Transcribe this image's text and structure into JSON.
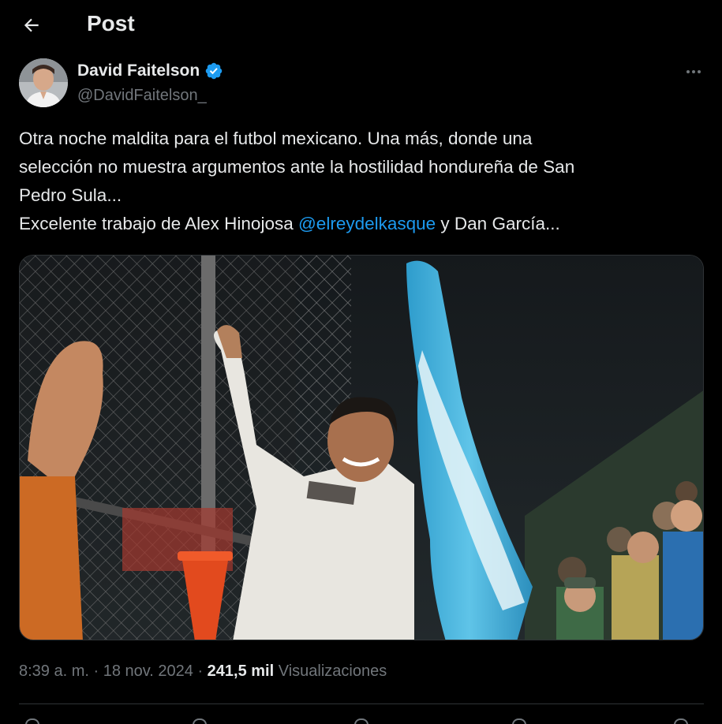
{
  "header": {
    "back_icon": "arrow-left-icon",
    "title": "Post"
  },
  "author": {
    "name": "David Faitelson",
    "handle": "@DavidFaitelson_",
    "verified_icon": "verified-badge-icon",
    "verified_color": "#1d9bf0",
    "more_icon": "more-horizontal-icon"
  },
  "post": {
    "line1": "Otra noche maldita para el futbol mexicano. Una más, donde una",
    "line2": "selección no muestra argumentos ante la hostilidad hondureña de San",
    "line3": "Pedro Sula...",
    "line4_before": "Excelente trabajo de Alex Hinojosa ",
    "line4_mention": "@elreydelkasque",
    "line4_after": " y Dan García...",
    "mention_color": "#1d9bf0"
  },
  "meta": {
    "time": "8:39 a. m.",
    "separator": " · ",
    "date": "18 nov. 2024",
    "views_count": "241,5 mil",
    "views_label": "Visualizaciones"
  },
  "actions": {
    "icons": [
      "reply-icon",
      "repost-icon",
      "like-icon",
      "bookmark-icon",
      "share-icon"
    ]
  },
  "colors": {
    "background": "#000000",
    "text": "#e7e9ea",
    "secondary_text": "#71767b",
    "divider": "#2f3336",
    "flag_blue": "#49b8e0"
  }
}
